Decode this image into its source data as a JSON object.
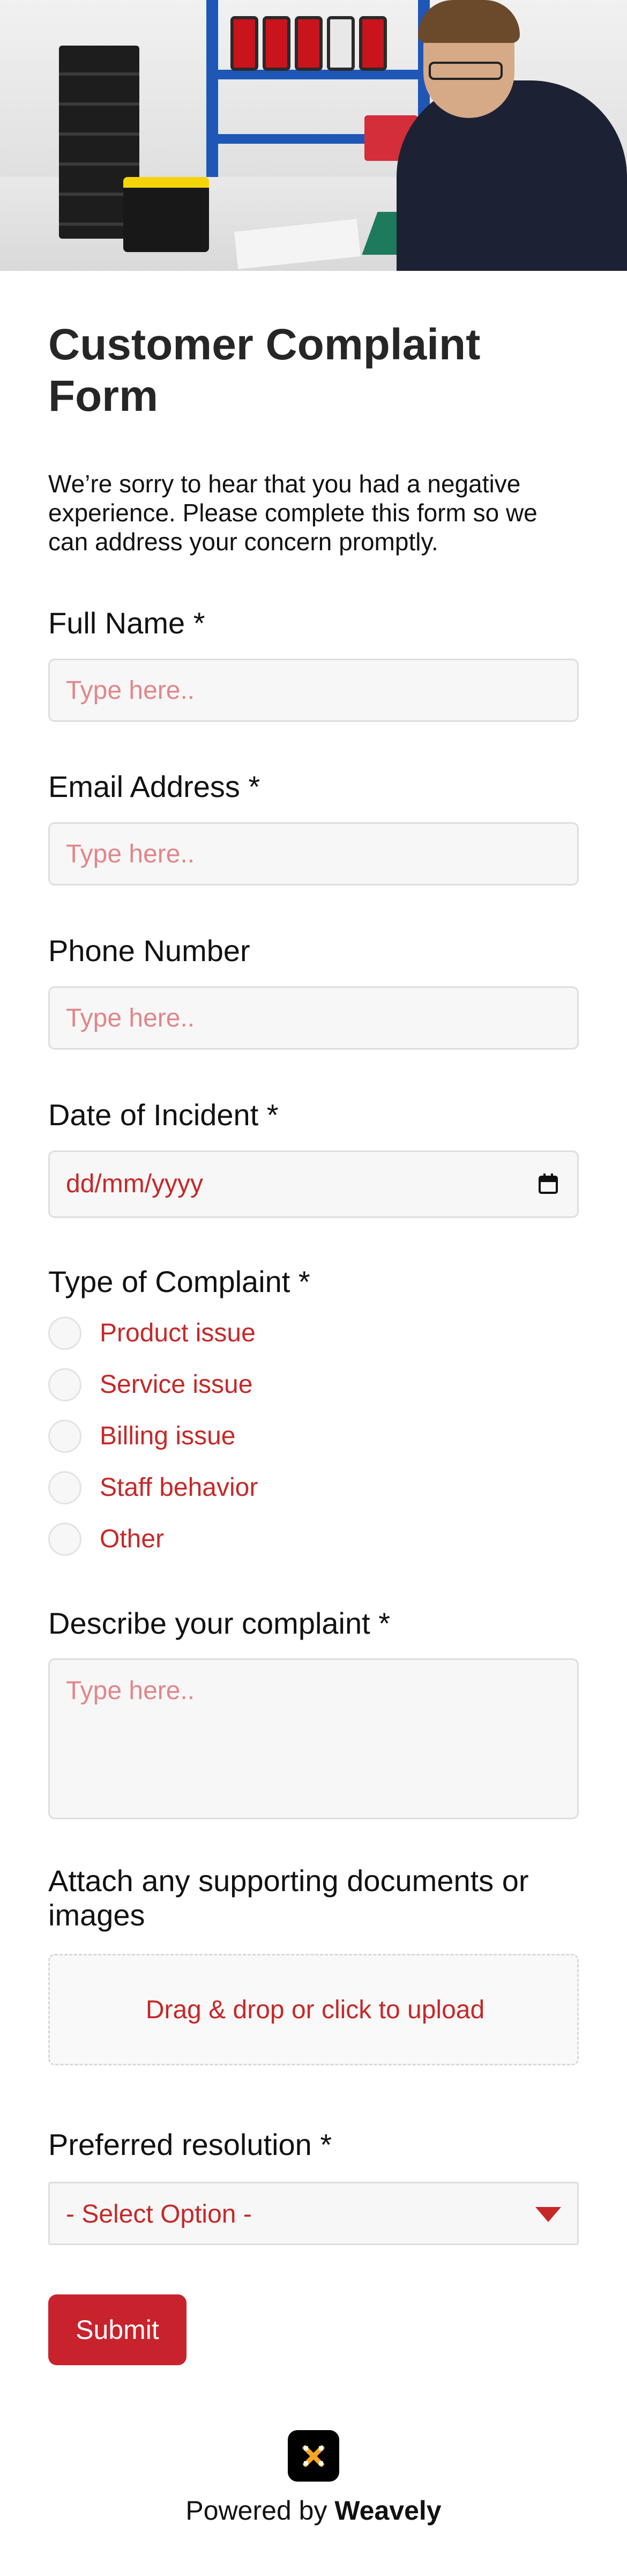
{
  "form": {
    "title": "Customer Complaint Form",
    "intro": "We’re sorry to hear that you had a negative experience. Please complete this form so we can address your concern promptly.",
    "full_name": {
      "label": "Full Name *",
      "placeholder": "Type here.."
    },
    "email": {
      "label": "Email Address *",
      "placeholder": "Type here.."
    },
    "phone": {
      "label": "Phone Number",
      "placeholder": "Type here.."
    },
    "date": {
      "label": "Date of Incident *",
      "value": "dd/mm/yyyy"
    },
    "complaint_type": {
      "label": "Type of Complaint *",
      "options": [
        "Product issue",
        "Service issue",
        "Billing issue",
        "Staff behavior",
        "Other"
      ]
    },
    "description": {
      "label": "Describe your complaint *",
      "placeholder": "Type here.."
    },
    "attachments": {
      "label": "Attach any supporting documents or images",
      "upload_text": "Drag & drop or click to upload"
    },
    "resolution": {
      "label": "Preferred resolution *",
      "selected": "- Select Option -"
    },
    "submit_label": "Submit"
  },
  "footer": {
    "prefix": "Powered by",
    "brand": "Weavely"
  },
  "colors": {
    "accent": "#c8232c",
    "text_accent": "#c62828",
    "field_bg": "#f7f7f7"
  },
  "icons": {
    "date": "calendar-icon",
    "select": "chevron-down-icon",
    "logo": "weavely-logo-icon"
  }
}
